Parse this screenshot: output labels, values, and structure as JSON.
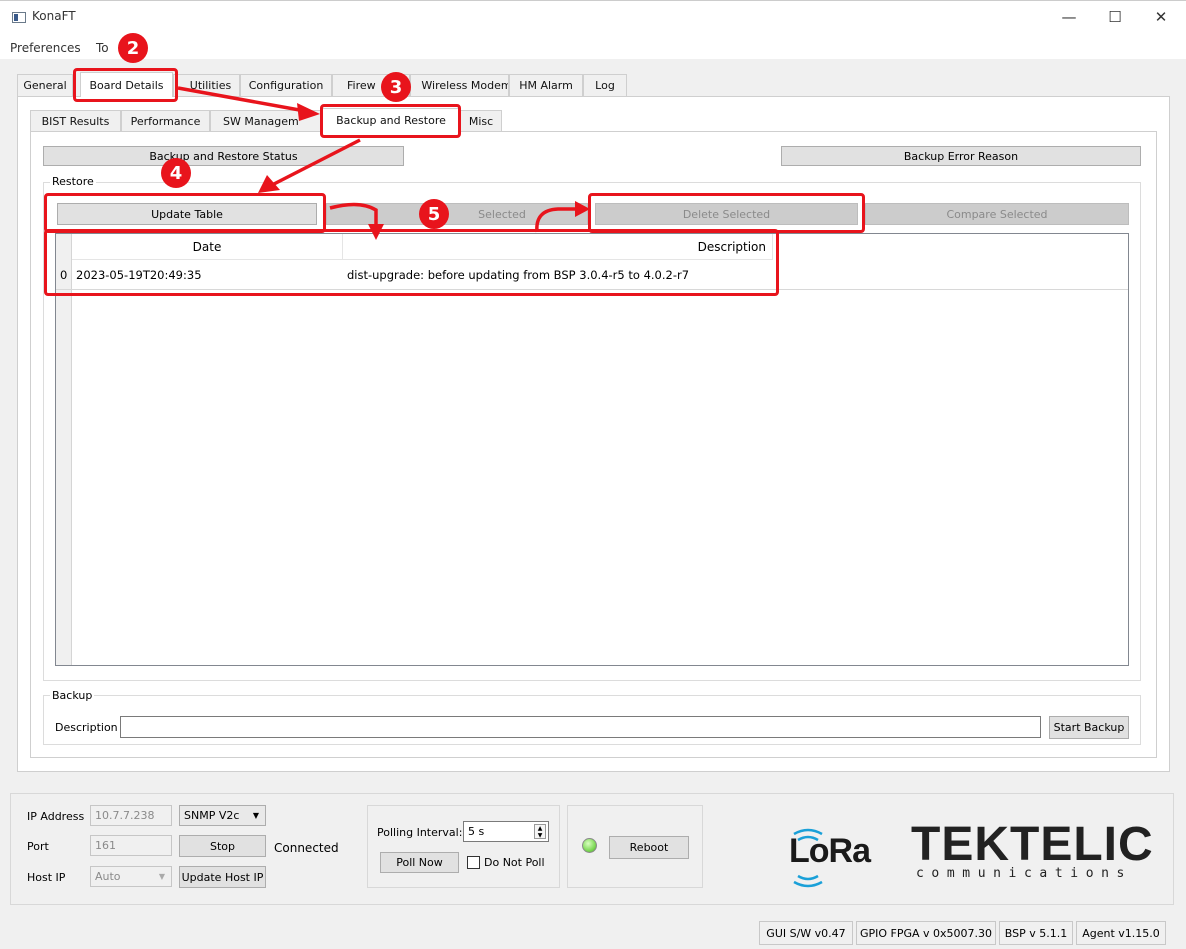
{
  "window": {
    "title": "KonaFT"
  },
  "menu": {
    "items": [
      "Preferences",
      "To"
    ]
  },
  "tabs": [
    "General",
    "Board Details",
    "Utilities",
    "Configuration",
    "Firew",
    "Wireless Modem",
    "HM Alarm",
    "Log"
  ],
  "subtabs": [
    "BIST Results",
    "Performance",
    "SW Managem",
    "Backup and Restore",
    "Misc"
  ],
  "status_buttons": {
    "backup_status": "Backup and Restore Status",
    "error_reason": "Backup Error Reason"
  },
  "restore": {
    "label": "Restore",
    "update_table": "Update Table",
    "restore_selected": "Selected",
    "delete_selected": "Delete Selected",
    "compare_selected": "Compare Selected",
    "columns": [
      "Date",
      "Description"
    ],
    "rows": [
      {
        "index": "0",
        "date": "2023-05-19T20:49:35",
        "description": "dist-upgrade: before updating from BSP 3.0.4-r5 to 4.0.2-r7"
      }
    ]
  },
  "backup": {
    "label": "Backup",
    "description_label": "Description",
    "description_value": "",
    "start": "Start Backup"
  },
  "connection": {
    "ip_label": "IP Address",
    "ip_value": "10.7.7.238",
    "snmp": "SNMP V2c",
    "port_label": "Port",
    "port_value": "161",
    "stop": "Stop",
    "state": "Connected",
    "host_label": "Host IP",
    "host_value": "Auto",
    "update_host": "Update Host IP"
  },
  "polling": {
    "label": "Polling Interval:",
    "value": "5 s",
    "poll_now": "Poll Now",
    "do_not_poll": "Do Not Poll"
  },
  "reboot": {
    "label": "Reboot",
    "led_color": "#7ed957"
  },
  "logos": {
    "lora": "LoRa",
    "tektelic": "TEKTELIC",
    "communications": "communications"
  },
  "statusbar": [
    "GUI S/W v0.47",
    "GPIO FPGA v 0x5007.30",
    "BSP v 5.1.1",
    "Agent v1.15.0"
  ],
  "annotations": [
    "2",
    "3",
    "4",
    "5"
  ],
  "accent": "#e8141c"
}
